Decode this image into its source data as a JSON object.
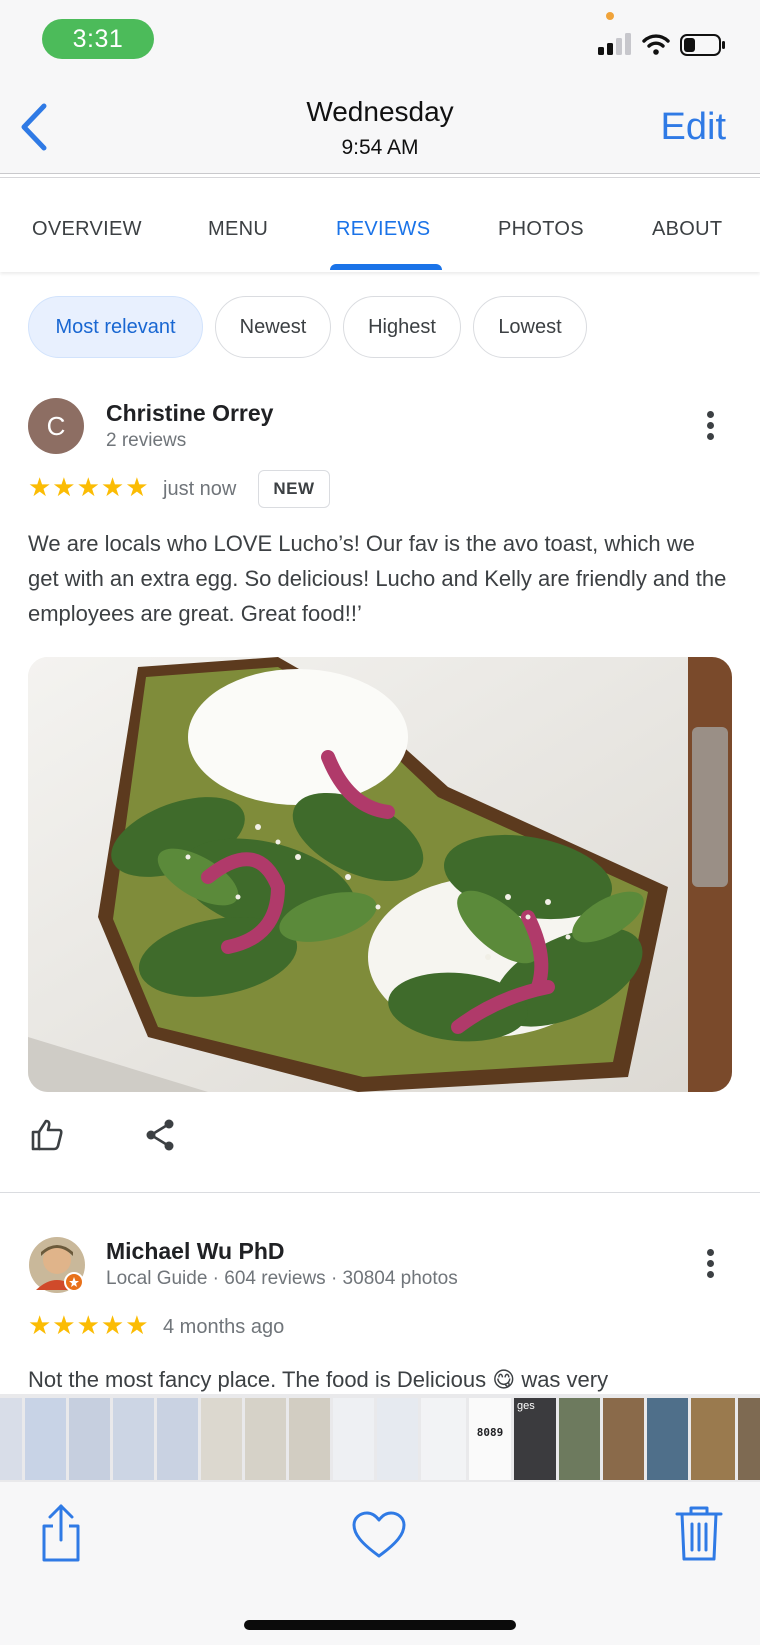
{
  "status_bar": {
    "time": "3:31",
    "colors": {
      "time_pill": "#4cbb5a",
      "privacy_dot": "#f0a33a"
    }
  },
  "nav": {
    "title": "Wednesday",
    "subtitle": "9:54 AM",
    "edit_label": "Edit",
    "back_icon": "chevron-left-icon"
  },
  "tabs": [
    "OVERVIEW",
    "MENU",
    "REVIEWS",
    "PHOTOS",
    "ABOUT"
  ],
  "active_tab": "REVIEWS",
  "sort_chips": [
    "Most relevant",
    "Newest",
    "Highest",
    "Lowest"
  ],
  "selected_chip": "Most relevant",
  "reviews": [
    {
      "avatar_letter": "C",
      "name": "Christine Orrey",
      "meta": "2 reviews",
      "stars": "★★★★★",
      "rating": 5,
      "time": "just now",
      "badge": "NEW",
      "text": "We are locals who LOVE Lucho’s! Our fav is the avo toast, which we get with an extra egg. So delicious! Lucho and Kelly are friendly and the employees are great. Great food!!’"
    },
    {
      "name": "Michael Wu PhD",
      "meta": "Local Guide · 604 reviews · 30804 photos",
      "stars": "★★★★★",
      "rating": 5,
      "time": "4 months ago",
      "text": "Not the most fancy place. The food is Delicious 😋 was very"
    }
  ],
  "thumbnails": {
    "text_a": "ges",
    "text_b": "8089"
  },
  "toolbar": {
    "icons": [
      "share-icon",
      "heart-icon",
      "trash-icon"
    ]
  },
  "colors": {
    "accent": "#1a73e8",
    "ios_blue": "#2f7ae5",
    "star": "#fbbc04",
    "chip_selected_bg": "#e8f0fe"
  }
}
